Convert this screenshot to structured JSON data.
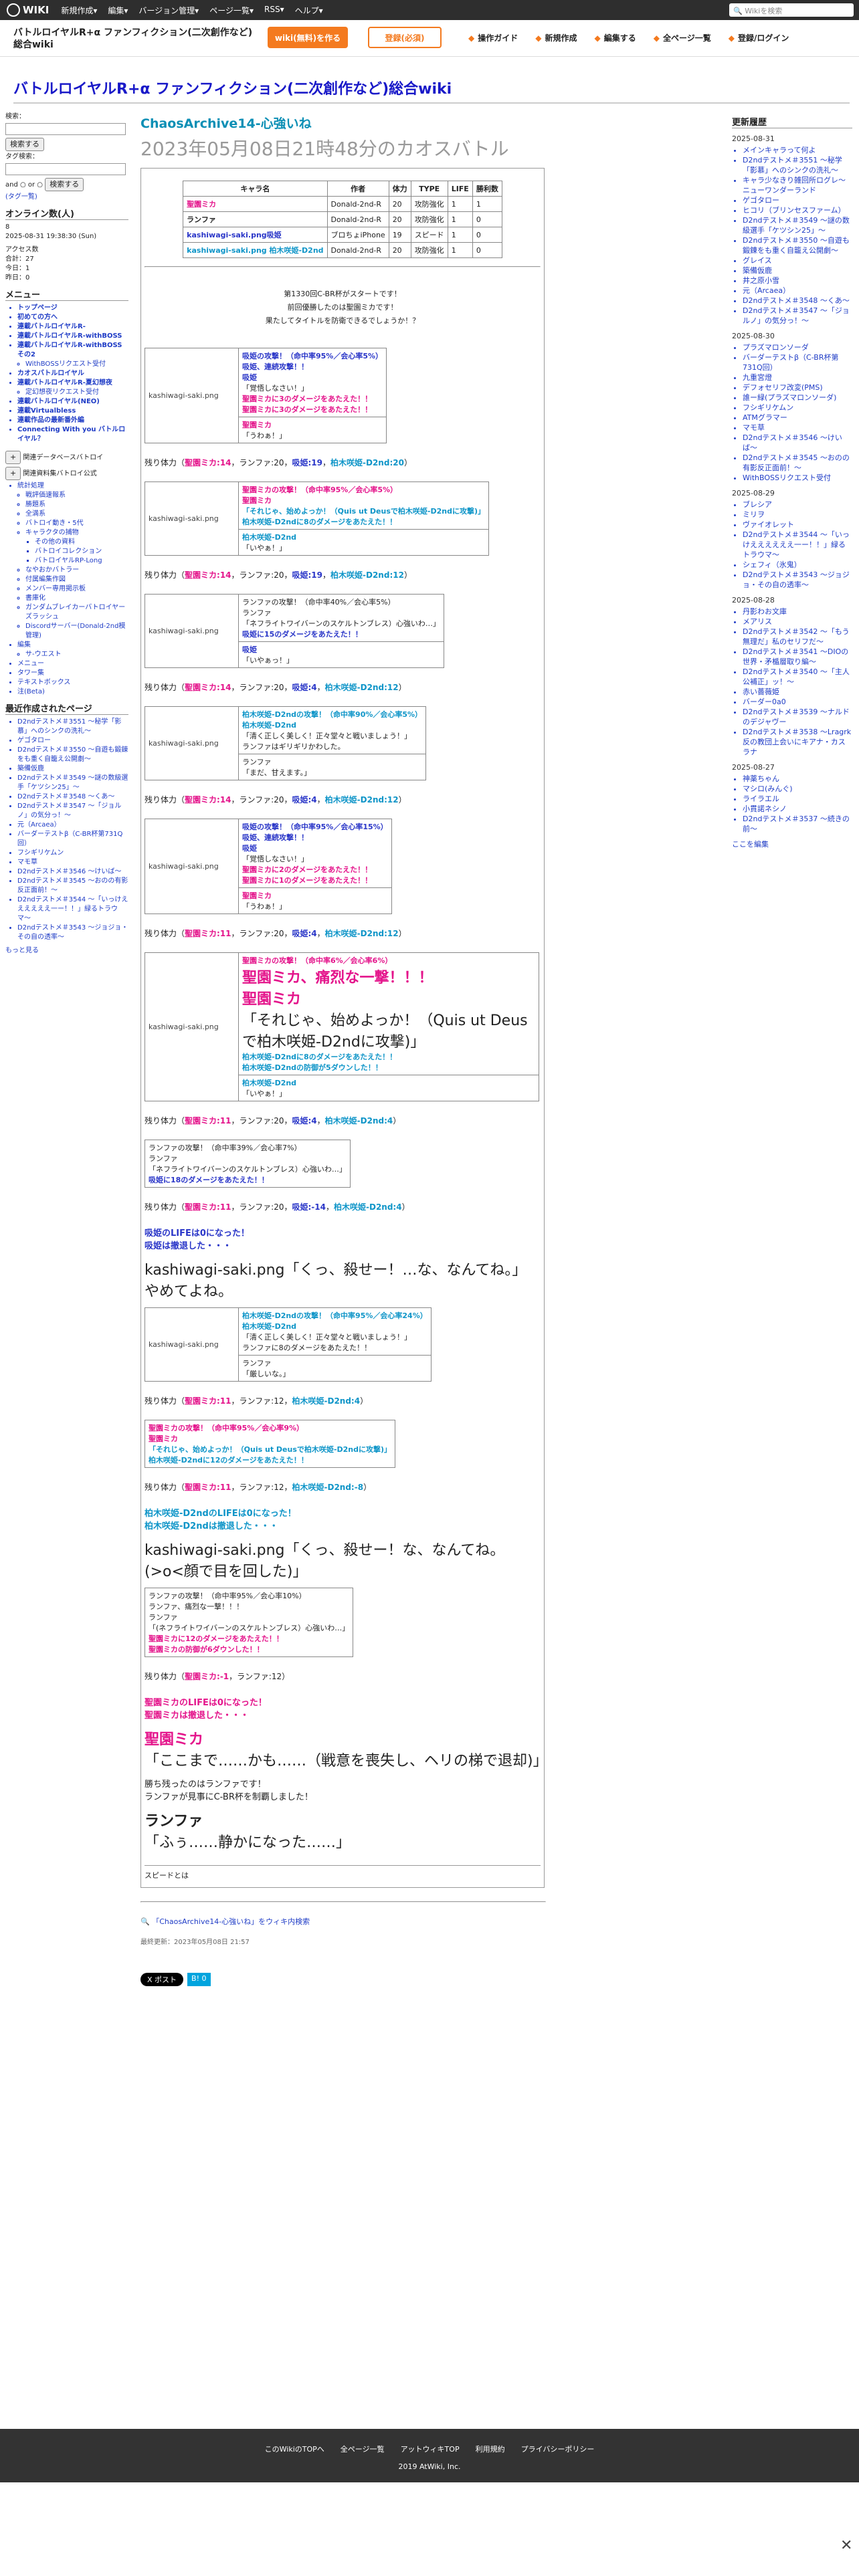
{
  "topbar": {
    "logo": "WIKI",
    "menu": [
      "新規作成▾",
      "編集▾",
      "バージョン管理▾",
      "ページ一覧▾",
      "RSS▾",
      "ヘルプ▾"
    ],
    "search_placeholder": "Wikiを検索"
  },
  "header": {
    "wiki_name": "バトルロイヤルR+α ファンフィクション(二次創作など)総合wiki",
    "btn_create": "wiki(無料)を作る",
    "btn_register": "登録(必須)",
    "links": [
      "操作ガイド",
      "新規作成",
      "編集する",
      "全ページ一覧",
      "登録/ログイン"
    ]
  },
  "site_title": "バトルロイヤルR+α ファンフィクション(二次創作など)総合wiki",
  "sidebar": {
    "search_label": "検索：",
    "search_button": "検索する",
    "tag_label": "タグ検索：",
    "and_or": "and ○ or ○",
    "tag_search_button": "検索する",
    "tag_cloud": "(タグ一覧)",
    "online_title": "オンライン数(人)",
    "online_value": "8",
    "datetime": "2025-08-31 19:38:30 (Sun)",
    "access_title": "アクセス数",
    "access": [
      "合計：27",
      "今日：1",
      "昨日：0"
    ],
    "menu_title": "メニュー",
    "menu_items": [
      {
        "label": "トップページ",
        "level": 0
      },
      {
        "label": "初めての方へ",
        "level": 0
      },
      {
        "label": "連載バトルロイヤルR-",
        "level": 0
      },
      {
        "label": "連載バトルロイヤルR-withBOSS",
        "level": 0
      },
      {
        "label": "連載バトルロイヤルR-withBOSSその2",
        "level": 0
      },
      {
        "label": "WithBOSSリクエスト受付",
        "level": 1
      },
      {
        "label": "カオスバトルロイヤル",
        "level": 0
      },
      {
        "label": "連載バトルロイヤルR-夏幻想夜",
        "level": 0
      },
      {
        "label": "定幻想夜リクエスト受付",
        "level": 1
      },
      {
        "label": "連載バトルロイヤル(NEO)",
        "level": 0
      },
      {
        "label": "連載Virtualbless",
        "level": 0
      },
      {
        "label": "連載作品の最新番外編",
        "level": 0
      },
      {
        "label": "Connecting With you バトルロイヤル？",
        "level": 0
      }
    ],
    "toggle_labels": [
      "関連データベースバトロイ",
      "関連資料集バトロイ公式"
    ],
    "tree_items": [
      {
        "label": "統計処理",
        "level": 1
      },
      {
        "label": "戦評価速報系",
        "level": 2
      },
      {
        "label": "勝題系",
        "level": 2
      },
      {
        "label": "全満系",
        "level": 2
      },
      {
        "label": "バトロイ動き・5代",
        "level": 2
      },
      {
        "label": "キャラクタの捕物",
        "level": 2
      },
      {
        "label": "その他の資料",
        "level": 3
      },
      {
        "label": "バトロイコレクション",
        "level": 3
      },
      {
        "label": "バトロイヤルRP-Long",
        "level": 3
      },
      {
        "label": "なやおかバトラー",
        "level": 2
      },
      {
        "label": "付属編集作図",
        "level": 2
      },
      {
        "label": "メンバー専用掲示板",
        "level": 2
      },
      {
        "label": "書庫化",
        "level": 2
      },
      {
        "label": "ガンダムブレイカーバトロイヤーズラッシュ",
        "level": 2
      },
      {
        "label": "Discordサーバー(Donald-2nd模管理)",
        "level": 2
      },
      {
        "label": "編集",
        "level": 1
      },
      {
        "label": "サ-ウエスト",
        "level": 2
      },
      {
        "label": "メニュー",
        "level": 0
      },
      {
        "label": "タワー集",
        "level": 0
      },
      {
        "label": "テキストボックス",
        "level": 0
      },
      {
        "label": "注(Beta)",
        "level": 0
      }
    ],
    "recent_title": "最近作成されたページ",
    "recent_items": [
      "D2ndテストメ＃3551 〜秘学「影慕」へのシンクの洗礼〜",
      "ゲゴタロー",
      "D2ndテストメ＃3550 〜自遊も鍛錬をも重く自籠え公開劇〜",
      "築備仮鹿",
      "D2ndテストメ＃3549 〜謎の数級選手「ケツシン25」〜",
      "D2ndテストメ＃3548 〜くあ〜",
      "D2ndテストメ＃3547 〜「ジョルノ」の気分っ！〜",
      "元（Arcaea）",
      "バーダーテストβ（C-BR杯第731Q回）",
      "フシギリケムン",
      "マモ草",
      "D2ndテストメ＃3546 〜けいば〜",
      "D2ndテストメ＃3545 〜おのの有影反正面前！〜",
      "D2ndテストメ＃3544 〜「いっけええええええ一ー！！」緑るトラウマ〜",
      "D2ndテストメ＃3543 〜ジョジョ・その自の透率〜"
    ],
    "more": "もっと見る"
  },
  "main": {
    "page_title": "ChaosArchive14-心強いね",
    "heading": "2023年05月08日21時48分のカオスバトル",
    "roster_headers": [
      "キャラ名",
      "作者",
      "体力",
      "TYPE",
      "LIFE",
      "勝利数"
    ],
    "roster": [
      {
        "name": "聖園ミカ",
        "color": "pink",
        "author": "Donald-2nd-R",
        "hp": "20",
        "type": "攻防強化",
        "life": "1",
        "wins": "1"
      },
      {
        "name": "ランファ",
        "color": "dark",
        "author": "Donald-2nd-R",
        "hp": "20",
        "type": "攻防強化",
        "life": "1",
        "wins": "0"
      },
      {
        "name": "kashiwagi-saki.png吸姫",
        "color": "blue",
        "author": "ブロちょiPhone",
        "hp": "19",
        "type": "スピード",
        "life": "1",
        "wins": "0"
      },
      {
        "name": "kashiwagi-saki.png 柏木咲姫-D2nd",
        "color": "teal",
        "author": "Donald-2nd-R",
        "hp": "20",
        "type": "攻防強化",
        "life": "1",
        "wins": "0"
      }
    ],
    "intro": [
      "第1330回C-BR杯がスタートです！",
      "前回優勝したのは聖園ミカです！",
      "果たしてタイトルを防衛できるでしょうか！？"
    ],
    "img_alt": "kashiwagi-saki.png",
    "scenes": [
      {
        "lines": [
          "吸姫の攻撃！（命中率95%／会心率5%）",
          "吸姫、連続攻撃！！",
          "吸姫",
          "「覚悟しなさい！」",
          "聖園ミカに3のダメージをあたえた！！",
          "聖園ミカに3のダメージをあたえた！！"
        ],
        "reply": [
          "聖園ミカ",
          "「うわぁ！」"
        ]
      },
      {
        "lines": [
          "聖園ミカの攻撃！（命中率95%／会心率5%）",
          "聖園ミカ",
          "「それじゃ、始めよっか！（Quis ut Deusで柏木咲姫-D2ndに攻撃)」",
          "柏木咲姫-D2ndに8のダメージをあたえた！！"
        ],
        "reply": [
          "柏木咲姫-D2nd",
          "「いやぁ！」"
        ]
      },
      {
        "lines": [
          "ランファの攻撃！（命中率40%／会心率5%）",
          "ランファ",
          "「ネフライトワイバーンのスケルトンブレス）心強いわ…」",
          "吸姫に15のダメージをあたえた！！"
        ],
        "reply": [
          "吸姫",
          "「いやぁっ！」"
        ]
      },
      {
        "lines": [
          "柏木咲姫-D2ndの攻撃！（命中率90%／会心率5%）",
          "柏木咲姫-D2nd",
          "「清く正しく美しく！正々堂々と戦いましょう！」",
          "ランファはギリギリかわした。"
        ],
        "reply": [
          "ランファ",
          "「まだ、甘えます。」"
        ]
      },
      {
        "lines": [
          "吸姫の攻撃！（命中率95%／会心率15%）",
          "吸姫、連続攻撃！！",
          "吸姫",
          "「覚悟しなさい！」",
          "聖園ミカに2のダメージをあたえた！！",
          "聖園ミカに1のダメージをあたえた！！"
        ],
        "reply": [
          "聖園ミカ",
          "「うわぁ！」"
        ]
      }
    ],
    "crit_scene": {
      "head": "聖園ミカの攻撃！（命中率6%／会心率6%）",
      "crit": "聖園ミカ、痛烈な一撃！！！",
      "name": "聖園ミカ",
      "quote": "「それじゃ、始めよっか！（Quis ut Deusで柏木咲姫-D2ndに攻撃)」",
      "dmg": "柏木咲姫-D2ndに8のダメージをあたえた！！",
      "def": "柏木咲姫-D2ndの防御が5ダウンした！！",
      "reply": [
        "柏木咲姫-D2nd",
        "「いやぁ！」"
      ]
    },
    "scene7": [
      "ランファの攻撃！（命中率39%／会心率7%）",
      "ランファ",
      "「ネフライトワイバーンのスケルトンブレス）心強いわ…」",
      "吸姫に18のダメージをあたえた！！"
    ],
    "ko1": [
      "吸姫のLIFEは0になった！",
      "吸姫は撤退した・・・"
    ],
    "ko1_quote": "「くっ、殺せー！…な、なんてね。」",
    "ko1_after": "やめてよね。",
    "scene8": {
      "lines": [
        "柏木咲姫-D2ndの攻撃！（命中率95%／会心率24%）",
        "柏木咲姫-D2nd",
        "「清く正しく美しく！正々堂々と戦いましょう！」",
        "ランファに8のダメージをあたえた！！"
      ],
      "reply": [
        "ランファ",
        "「厳しいな。」"
      ]
    },
    "scene9": [
      "聖園ミカの攻撃！（命中率95%／会心率9%）",
      "聖園ミカ",
      "「それじゃ、始めよっか！（Quis ut Deusで柏木咲姫-D2ndに攻撃)」",
      "柏木咲姫-D2ndに12のダメージをあたえた！！"
    ],
    "ko2": [
      "柏木咲姫-D2ndのLIFEは0になった！",
      "柏木咲姫-D2ndは撤退した・・・"
    ],
    "ko2_quote": "「くっ、殺せー！な、なんてね。(>o<顔で目を回した)」",
    "scene10": [
      "ランファの攻撃！（命中率95%／会心率10%）",
      "ランファ、痛烈な一撃！！！",
      "ランファ",
      "「(ネフライトワイバーンのスケルトンブレス）心強いわ…」",
      "聖園ミカに12のダメージをあたえた！！",
      "聖園ミカの防御が6ダウンした！！"
    ],
    "ko3": [
      "聖園ミカのLIFEは0になった！",
      "聖園ミカは撤退した・・・"
    ],
    "ko3_name": "聖園ミカ",
    "ko3_quote": "「ここまで……かも……（戦意を喪失し、ヘリの梯で退却)」",
    "winner": [
      "勝ち残ったのはランファです！",
      "ランファが見事にC-BR杯を制覇しました！"
    ],
    "winner_name": "ランファ",
    "winner_quote": "「ふぅ……静かになった……」",
    "hp_lines": [
      [
        "残り体力（",
        "聖園ミカ:14",
        "ランファ:20",
        "吸姫:19",
        "柏木咲姫-D2nd:20",
        "）"
      ],
      [
        "残り体力（",
        "聖園ミカ:14",
        "ランファ:20",
        "吸姫:19",
        "柏木咲姫-D2nd:12",
        "）"
      ],
      [
        "残り体力（",
        "聖園ミカ:14",
        "ランファ:20",
        "吸姫:4",
        "柏木咲姫-D2nd:12",
        "）"
      ],
      [
        "残り体力（",
        "聖園ミカ:14",
        "ランファ:20",
        "吸姫:4",
        "柏木咲姫-D2nd:12",
        "）"
      ],
      [
        "残り体力（",
        "聖園ミカ:11",
        "ランファ:20",
        "吸姫:4",
        "柏木咲姫-D2nd:12",
        "）"
      ],
      [
        "残り体力（",
        "聖園ミカ:11",
        "ランファ:20",
        "吸姫:4",
        "柏木咲姫-D2nd:4",
        "）"
      ],
      [
        "残り体力（",
        "聖園ミカ:11",
        "ランファ:20",
        "吸姫:-14",
        "柏木咲姫-D2nd:4",
        "）"
      ],
      [
        "残り体力（",
        "聖園ミカ:11",
        "ランファ:12",
        "柏木咲姫-D2nd:4",
        "",
        "）"
      ],
      [
        "残り体力（",
        "聖園ミカ:11",
        "ランファ:12",
        "柏木咲姫-D2nd:-8",
        "",
        "）"
      ],
      [
        "残り体力（",
        "聖園ミカ:-1",
        "ランファ:12",
        "",
        "",
        "）"
      ]
    ],
    "speed_label": "スピードとは",
    "wiki_search": "「ChaosArchive14-心強いね」をウィキ内検索",
    "updated": "最終更新：2023年05月08日 21:57",
    "share_x": "ポスト",
    "share_b": "B! 0"
  },
  "rightbar": {
    "title": "更新履歴",
    "groups": [
      {
        "date": "2025-08-31",
        "items": [
          "メインキャラって何よ",
          "D2ndテストメ＃3551 〜秘学「影慕」へのシンクの洗礼〜",
          "キャラ少なきり雑回所ログレ～ニューワンダーランド",
          "ゲゴタロー",
          "ヒコリ（ブリンセスファーム）",
          "D2ndテストメ＃3549 〜謎の数級選手「ケツシン25」〜",
          "D2ndテストメ＃3550 〜自遊も鍛錬をも重く自籠え公開劇〜",
          "グレイス",
          "築備仮鹿",
          "井之原小雪",
          "元（Arcaea）",
          "D2ndテストメ＃3548 〜くあ〜",
          "D2ndテストメ＃3547 〜「ジョルノ」の気分っ！〜"
        ]
      },
      {
        "date": "2025-08-30",
        "items": [
          "プラズマロンソーダ",
          "バーダーテストβ（C-BR杯第731Q回）",
          "九重宮燈",
          "デフォセリフ改変(PMS)",
          "誰ー緑(プラズマロンソーダ)",
          "フシギリケムン",
          "ATMグラマー",
          "マモ草",
          "D2ndテストメ＃3546 〜けいば〜",
          "D2ndテストメ＃3545 〜おのの有影反正面前！〜",
          "WithBOSSリクエスト受付"
        ]
      },
      {
        "date": "2025-08-29",
        "items": [
          "ブレシア",
          "ミリヲ",
          "ヴァイオレット",
          "D2ndテストメ＃3544 〜「いっけええええええ一ー！！」緑るトラウマ〜",
          "シェフィ（氷鬼）",
          "D2ndテストメ＃3543 〜ジョジョ・その自の透率〜"
        ]
      },
      {
        "date": "2025-08-28",
        "items": [
          "丹影わお文庫",
          "メアリス",
          "D2ndテストメ＃3542 〜「もう無理だ」私のセリフだ〜",
          "D2ndテストメ＃3541 〜DIOの世界・矛楯層取り編〜",
          "D2ndテストメ＃3540 〜「主人公補正」ッ！〜",
          "赤い薔薇姫",
          "バーダー0a0",
          "D2ndテストメ＃3539 〜ナルドのデジャヴー",
          "D2ndテストメ＃3538 〜Lragrk反の教団上会いにキアナ・カスラナ"
        ]
      },
      {
        "date": "2025-08-27",
        "items": [
          "神薬ちゃん",
          "マシロ(みんぐ)",
          "ライラエル",
          "小貫諾ネシノ",
          "D2ndテストメ＃3537 〜続きの前〜"
        ]
      }
    ],
    "more": "ここを編集"
  },
  "footer": {
    "links": [
      "このWikiのTOPへ",
      "全ページ一覧",
      "アットウィキTOP",
      "利用規約",
      "プライバシーポリシー"
    ],
    "copyright": "2019 AtWiki, Inc."
  }
}
